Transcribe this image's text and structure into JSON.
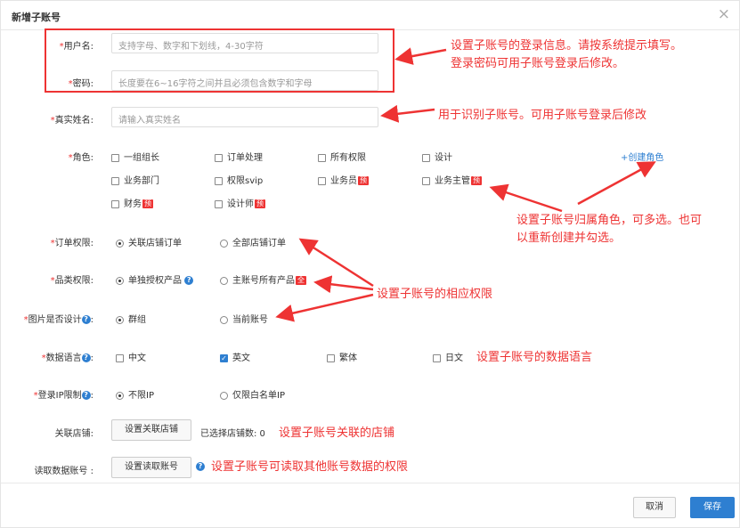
{
  "dialog": {
    "title": "新增子账号",
    "close": "×"
  },
  "fields": {
    "username": {
      "label": "用户名:",
      "placeholder": "支持字母、数字和下划线，4-30字符"
    },
    "password": {
      "label": "密码:",
      "placeholder": "长度要在6~16字符之间并且必须包含数字和字母"
    },
    "realname": {
      "label": "真实姓名:",
      "placeholder": "请输入真实姓名"
    },
    "role": {
      "label": "角色:",
      "options": [
        "一组组长",
        "订单处理",
        "所有权限",
        "设计",
        "业务部门",
        "权限svip",
        "业务员",
        "业务主管",
        "财务",
        "设计师"
      ],
      "tag": "预",
      "create_link": "+创建角色"
    },
    "order_perm": {
      "label": "订单权限:",
      "options": [
        "关联店铺订单",
        "全部店铺订单"
      ]
    },
    "category_perm": {
      "label": "品类权限:",
      "options": [
        "单独授权产品",
        "主账号所有产品"
      ],
      "tag": "全"
    },
    "image_design": {
      "label": "图片是否设计",
      "options": [
        "群组",
        "当前账号"
      ]
    },
    "data_lang": {
      "label": "数据语言",
      "options": [
        "中文",
        "英文",
        "繁体",
        "日文"
      ]
    },
    "ip_limit": {
      "label": "登录IP限制",
      "options": [
        "不限IP",
        "仅限白名单IP"
      ]
    },
    "shop": {
      "label": "关联店铺:",
      "button": "设置关联店铺",
      "count_text": "已选择店铺数: 0"
    },
    "read_account": {
      "label": "读取数据账号 :",
      "button": "设置读取账号"
    }
  },
  "footer": {
    "cancel": "取消",
    "save": "保存"
  },
  "annotations": {
    "login": "设置子账号的登录信息。请按系统提示填写。",
    "login2": "登录密码可用子账号登录后修改。",
    "realname": "用于识别子账号。可用子账号登录后修改",
    "role": "设置子账号归属角色，可多选。也可",
    "role2": "以重新创建并勾选。",
    "perm": "设置子账号的相应权限",
    "lang": "设置子账号的数据语言",
    "shop": "设置子账号关联的店铺",
    "read": "设置子账号可读取其他账号数据的权限"
  },
  "colors": {
    "primary": "#2e7fd1",
    "annotation": "#e33333"
  }
}
